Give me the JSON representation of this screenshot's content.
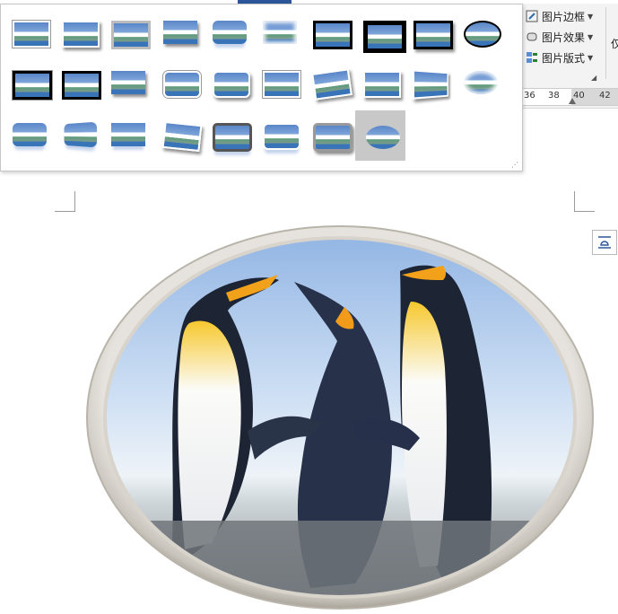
{
  "ribbon": {
    "buttons": [
      {
        "label": "图片边框",
        "icon": "pen-border-icon"
      },
      {
        "label": "图片效果",
        "icon": "effects-icon"
      },
      {
        "label": "图片版式",
        "icon": "picture-layout-icon"
      }
    ],
    "partial_label": "仅"
  },
  "ruler": {
    "ticks": [
      "36",
      "38",
      "40",
      "42"
    ]
  },
  "gallery": {
    "styles": [
      "simple-frame-white",
      "beveled-matte-white",
      "metal-frame",
      "drop-shadow-rectangle",
      "reflected-rounded-rectangle",
      "soft-edge-rectangle",
      "double-frame-black",
      "thick-matte-black",
      "simple-frame-black",
      "beveled-oval-black",
      "compound-frame-black",
      "center-shadow-rectangle",
      "rounded-diagonal-corner",
      "snip-diagonal-corner",
      "moderate-frame-white",
      "rotated-white",
      "perspective-shadow-white",
      "relaxed-perspective-white",
      "soft-edge-oval",
      "bevel-rectangle",
      "bevel-perspective",
      "reflected-bevel-white",
      "bevel-perspective-left",
      "metal-rounded-rectangle",
      "reflected-perspective-right",
      "metal-frame-rounded",
      "metal-oval"
    ],
    "selected_index": 26
  },
  "document": {
    "image_subject": "three emperor penguins in metal oval frame"
  }
}
